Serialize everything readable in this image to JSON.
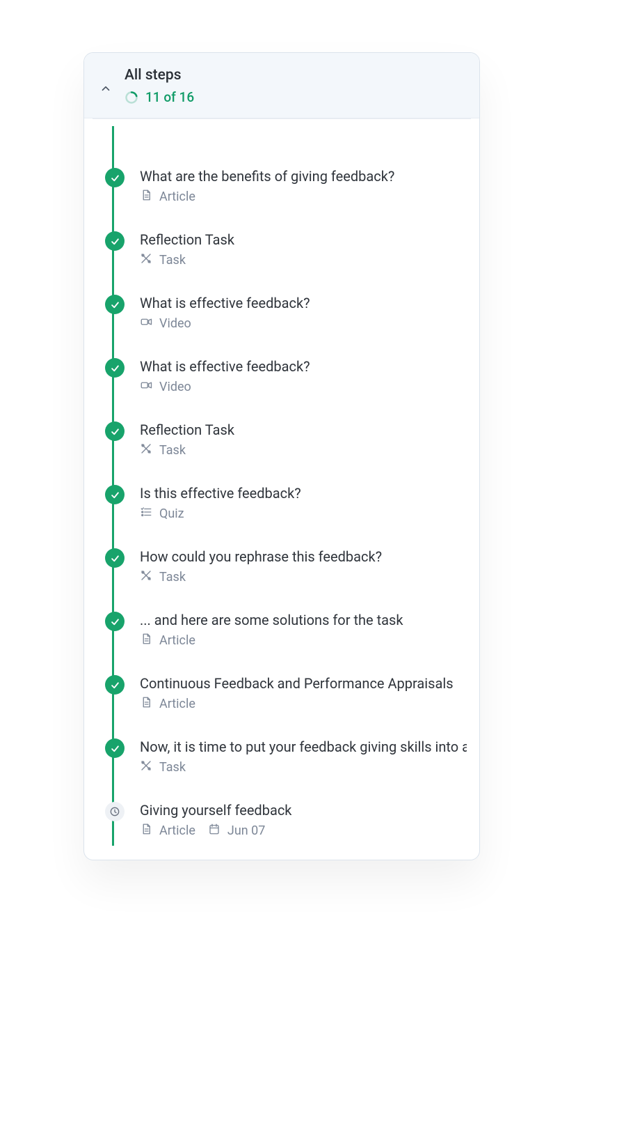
{
  "header": {
    "title": "All steps",
    "progress_text": "11 of 16"
  },
  "type_labels": {
    "article": "Article",
    "task": "Task",
    "video": "Video",
    "quiz": "Quiz"
  },
  "steps": [
    {
      "title": "What are the benefits of giving feedback?",
      "type": "article",
      "status": "done"
    },
    {
      "title": "Reflection Task",
      "type": "task",
      "status": "done"
    },
    {
      "title": "What is effective feedback?",
      "type": "video",
      "status": "done"
    },
    {
      "title": "What is effective feedback?",
      "type": "video",
      "status": "done"
    },
    {
      "title": "Reflection Task",
      "type": "task",
      "status": "done"
    },
    {
      "title": "Is this effective feedback?",
      "type": "quiz",
      "status": "done"
    },
    {
      "title": "How could you rephrase this feedback?",
      "type": "task",
      "status": "done"
    },
    {
      "title": "... and here are some solutions for the task",
      "type": "article",
      "status": "done"
    },
    {
      "title": "Continuous Feedback and Performance Appraisals",
      "type": "article",
      "status": "done"
    },
    {
      "title": "Now, it is time to put your feedback giving skills into ac",
      "type": "task",
      "status": "done"
    },
    {
      "title": "Giving yourself feedback",
      "type": "article",
      "status": "pending",
      "due": "Jun 07"
    }
  ]
}
